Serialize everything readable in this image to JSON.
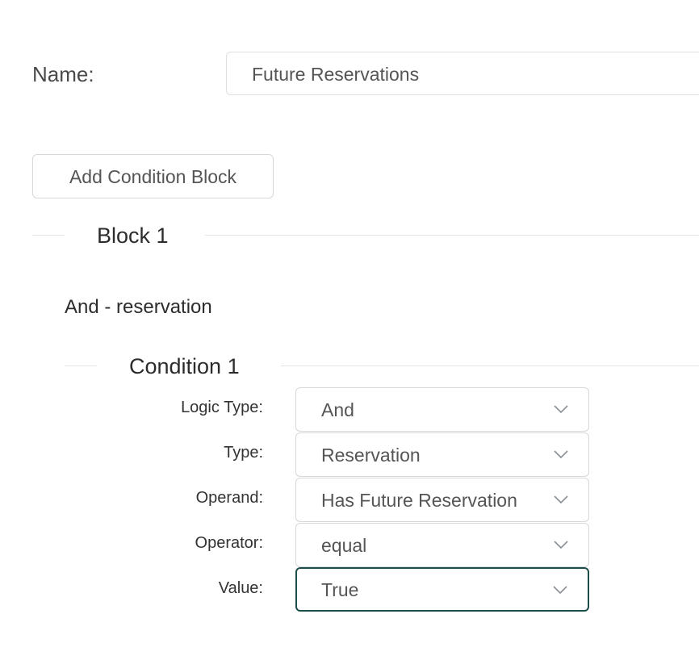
{
  "form": {
    "name_label": "Name:",
    "name_value": "Future Reservations",
    "add_block_label": "Add Condition Block"
  },
  "block": {
    "title": "Block 1",
    "summary": "And - reservation",
    "condition": {
      "title": "Condition 1",
      "fields": [
        {
          "label": "Logic Type:",
          "value": "And"
        },
        {
          "label": "Type:",
          "value": "Reservation"
        },
        {
          "label": "Operand:",
          "value": "Has Future Reservation"
        },
        {
          "label": "Operator:",
          "value": "equal"
        },
        {
          "label": "Value:",
          "value": "True"
        }
      ]
    }
  },
  "colors": {
    "focus_border": "#1d4f4a",
    "border": "#d4d7db",
    "divider": "#e2e4e7"
  },
  "icons": {
    "select_arrow": "chevron-down-icon"
  }
}
